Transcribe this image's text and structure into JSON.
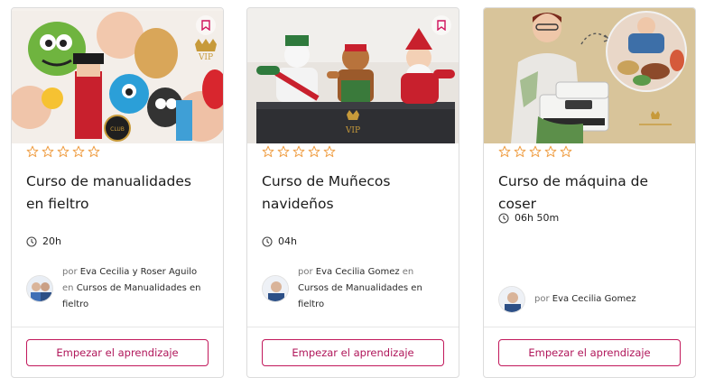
{
  "colors": {
    "accent": "#c2185b",
    "star": "#f0a24b"
  },
  "courses": [
    {
      "title": "Curso de manualidades en fieltro",
      "rating": 0,
      "duration": "20h",
      "author_prefix": "por",
      "author": "Eva Cecilia y Roser Aguilo",
      "category_prefix": "en",
      "category": "Cursos de Manualidades en fieltro",
      "cta": "Empezar el aprendizaje",
      "thumb_badge": "VIP",
      "thumb_logo": "CLUB"
    },
    {
      "title": "Curso de Muñecos navideños",
      "rating": 0,
      "duration": "04h",
      "author_prefix": "por",
      "author": "Eva Cecilia Gomez",
      "category_prefix": "en",
      "category": "Cursos de Manualidades en fieltro",
      "cta": "Empezar el aprendizaje",
      "thumb_badge": "VIP"
    },
    {
      "title": "Curso de máquina de coser",
      "rating": 0,
      "duration": "06h 50m",
      "author_prefix": "por",
      "author": "Eva Cecilia Gomez",
      "cta": "Empezar el aprendizaje"
    }
  ]
}
